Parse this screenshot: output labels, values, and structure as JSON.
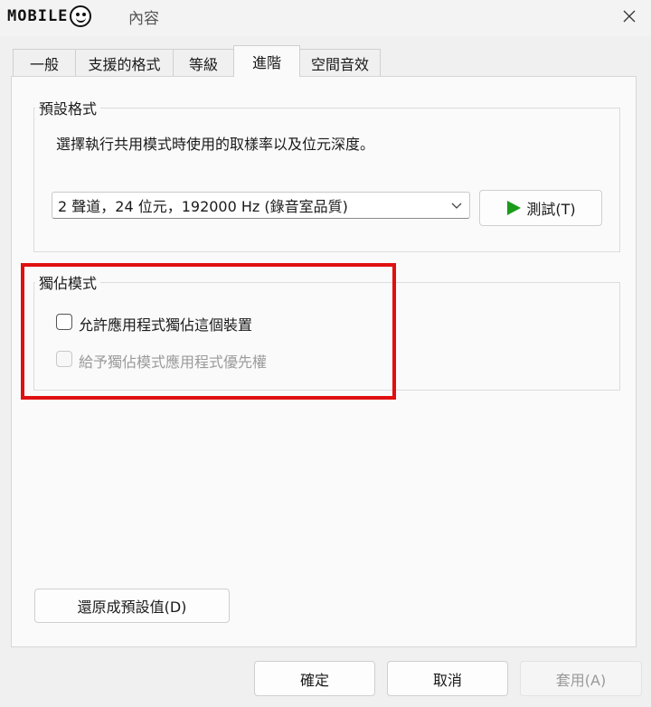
{
  "window": {
    "title": "內容",
    "logo_text": "MOBILE",
    "close_icon": "close-icon"
  },
  "tabs": [
    {
      "label": "一般",
      "active": false
    },
    {
      "label": "支援的格式",
      "active": false
    },
    {
      "label": "等級",
      "active": false
    },
    {
      "label": "進階",
      "active": true
    },
    {
      "label": "空間音效",
      "active": false
    }
  ],
  "default_format": {
    "title": "預設格式",
    "description": "選擇執行共用模式時使用的取樣率以及位元深度。",
    "selected_value": "2 聲道，24 位元，192000 Hz (錄音室品質)",
    "test_button": "測試(T)",
    "play_icon_color": "#1a9c1a"
  },
  "exclusive_mode": {
    "title": "獨佔模式",
    "allow_exclusive": {
      "label": "允許應用程式獨佔這個裝置",
      "checked": false,
      "enabled": true
    },
    "give_priority": {
      "label": "給予獨佔模式應用程式優先權",
      "checked": false,
      "enabled": false
    }
  },
  "restore_button": "還原成預設值(D)",
  "footer": {
    "ok": "確定",
    "cancel": "取消",
    "apply": "套用(A)"
  },
  "highlight_color": "#e01010"
}
